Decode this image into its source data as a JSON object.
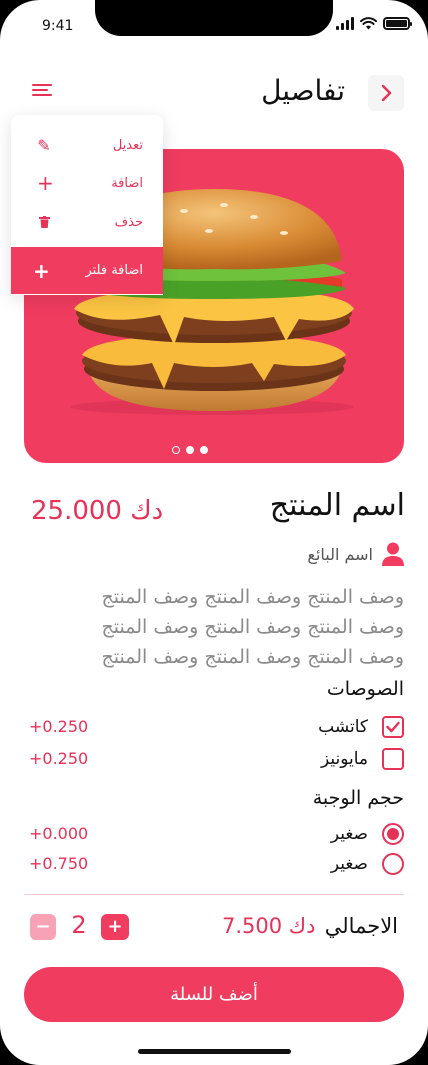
{
  "status_bar": {
    "time": "9:41"
  },
  "header": {
    "title": "تفاصيل"
  },
  "menu": {
    "items": [
      {
        "label": "تعديل",
        "icon": "edit-icon"
      },
      {
        "label": "اضافة",
        "icon": "plus-icon"
      },
      {
        "label": "حذف",
        "icon": "trash-icon"
      },
      {
        "label": "اضافة فلتر",
        "icon": "plus-bold-icon"
      }
    ]
  },
  "gallery": {
    "slides": 3,
    "active_index": 2
  },
  "product": {
    "name": "اسم المنتج",
    "price": "25.000 دك",
    "seller": "اسم البائع",
    "description": "وصف المنتج وصف المنتج وصف المنتج وصف المنتج وصف المنتج وصف المنتج وصف المنتج وصف المنتج وصف المنتج"
  },
  "sauces": {
    "title": "الصوصات",
    "options": [
      {
        "label": "كاتشب",
        "price": "+0.250",
        "checked": true
      },
      {
        "label": "مايونيز",
        "price": "+0.250",
        "checked": false
      }
    ]
  },
  "meal_size": {
    "title": "حجم الوجبة",
    "options": [
      {
        "label": "صغير",
        "price": "+0.000",
        "selected": true
      },
      {
        "label": "صغير",
        "price": "+0.750",
        "selected": false
      }
    ]
  },
  "total": {
    "label": "الاجمالي",
    "value": "7.500 دك"
  },
  "quantity": {
    "value": "2",
    "minus": "−",
    "plus": "+"
  },
  "cart_button": {
    "label": "أضف للسلة"
  },
  "colors": {
    "accent": "#f03c5f",
    "accent_text": "#e63257",
    "muted": "#8a8a8a"
  }
}
